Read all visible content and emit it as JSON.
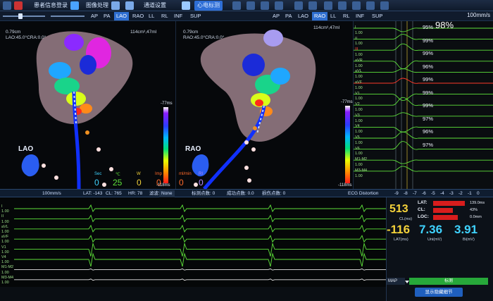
{
  "topbar": {
    "patient_info": "患者信息登录",
    "image_processing": "图像处理",
    "channel_settings": "通道设置",
    "active_tab": "心电标测"
  },
  "view_tabs": [
    "AP",
    "PA",
    "LAO",
    "RAO",
    "LL",
    "RL",
    "INF",
    "SUP"
  ],
  "view_tabs_right": [
    "AP",
    "PA",
    "LAO",
    "RAO",
    "LL",
    "RL",
    "INF",
    "SUP"
  ],
  "selected_view": "RAO",
  "sweep_speed": "100mm/s",
  "left_map": {
    "scale": "0.79cm",
    "angles": "LAO:45.0°CRA:0.0°",
    "volume": "114cm³,47ml",
    "view_label": "LAO",
    "colorbar_top": "-77ms",
    "colorbar_bottom": "-118ms"
  },
  "right_map": {
    "scale": "0.79cm",
    "angles": "RAO:45.0°CRA:0.0°",
    "volume": "114cm³,47ml",
    "view_label": "RAO",
    "colorbar_top": "-77ms",
    "colorbar_bottom": "-118ms"
  },
  "ablation": {
    "sec_label": "Sec",
    "sec_value": "0",
    "temp_label": "℃",
    "temp_value": "25",
    "power_label": "W",
    "power_value": "0",
    "imp_label": "Imp",
    "imp_value": "0",
    "flow_label": "ml/min",
    "flow_value": "0",
    "ri_label": "RI",
    "ri_value": "0"
  },
  "match_percent": "98%",
  "lead_percents": [
    "95%",
    "99%",
    "99%",
    "96%",
    "99%",
    "99%",
    "99%",
    "97%",
    "96%",
    "97%"
  ],
  "ecg_leads_top": [
    "I",
    "1.00",
    "II",
    "1.00",
    "III",
    "1.00",
    "aVR",
    "1.00",
    "aVL",
    "1.00",
    "aVF",
    "1.00",
    "V1",
    "1.00",
    "V2",
    "1.00",
    "V3",
    "1.00",
    "V4",
    "1.00",
    "V5",
    "1.00",
    "V6",
    "1.00",
    "M1-M2",
    "1.00",
    "M3-M4",
    "1.00"
  ],
  "status_bar": {
    "speed": "100mm/s",
    "lat": "LAT: -143",
    "cl": "CL: 765",
    "hr": "HR: 78",
    "filter_label": "滤波:",
    "filter_value": "None",
    "count1": "标测点数: 0",
    "count2": "成功点数: 0.0",
    "count3": "损伤点数: 0",
    "distortion": "ECG Distortion",
    "scale_ticks": [
      "-9",
      "-8",
      "-7",
      "-6",
      "-5",
      "-4",
      "-3",
      "-2",
      "-1",
      "0"
    ]
  },
  "lower_leads": [
    "I",
    "1.00",
    "II",
    "1.00",
    "aVL",
    "1.00",
    "aVF",
    "1.00",
    "V1",
    "1.00",
    "V4",
    "1.00",
    "M1-M2",
    "1.00",
    "M3-M4",
    "1.00"
  ],
  "stats": {
    "cl_value": "513",
    "cl_caption": "CL(ms)",
    "lat_value": "-116",
    "lat_caption": "LAT(ms)",
    "uni_value": "7.36",
    "uni_caption": "Uni(mV)",
    "bi_value": "3.91",
    "bi_caption": "Bi(mV)",
    "bars": [
      {
        "label": "LAT:",
        "value": "139.0ms",
        "fill": 0.9
      },
      {
        "label": "CL:",
        "value": "43%",
        "fill": 0.55
      },
      {
        "label": "LOC:",
        "value": "0.0mm",
        "fill": 0.7
      }
    ],
    "map_label": "MAP",
    "green_button": "标测",
    "bottom_button": "显示隐藏细节"
  },
  "colors": {
    "accent": "#2e6ed6",
    "ecg_green": "#5ee23a",
    "bar_red": "#d81d1d",
    "stat_yellow": "#f4d23a",
    "stat_cyan": "#3fd3ff"
  }
}
